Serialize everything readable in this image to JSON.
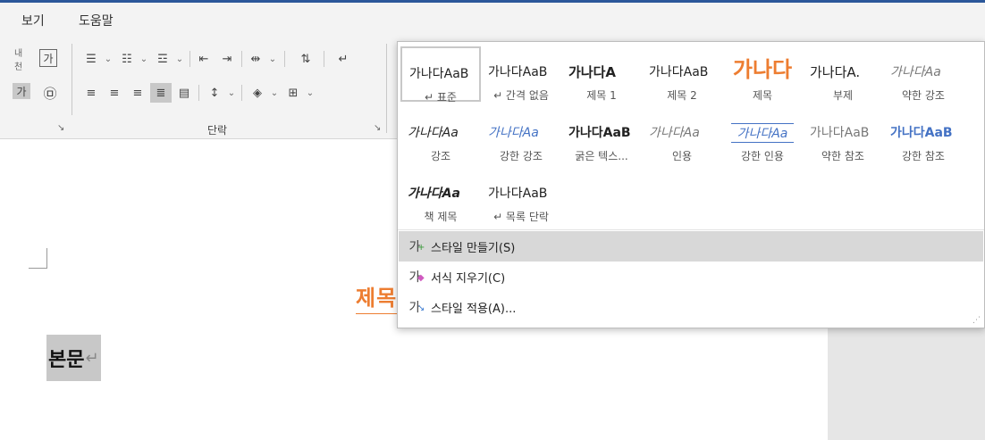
{
  "menu": {
    "items": [
      "보기",
      "도움말"
    ]
  },
  "ribbon": {
    "paragraph_group_label": "단락",
    "left_icons": {
      "phonetic": "내천",
      "char_border": "가",
      "shading": "가",
      "enclose": "㉤"
    },
    "launcher_glyph": "↘"
  },
  "gallery": {
    "styles": [
      {
        "preview": "가나다AaB",
        "name": "↵ 표준"
      },
      {
        "preview": "가나다AaB",
        "name": "↵ 간격 없음"
      },
      {
        "preview": "가나다A",
        "name": "제목 1"
      },
      {
        "preview": "가나다AaB",
        "name": "제목 2"
      },
      {
        "preview": "가나다",
        "name": "제목"
      },
      {
        "preview": "가나다A.",
        "name": "부제"
      },
      {
        "preview": "가나다Aa",
        "name": "약한 강조"
      },
      {
        "preview": "가나다Aa",
        "name": "강조"
      },
      {
        "preview": "가나다Aa",
        "name": "강한 강조"
      },
      {
        "preview": "가나다AaB",
        "name": "굵은 텍스..."
      },
      {
        "preview": "가나다Aa",
        "name": "인용"
      },
      {
        "preview": "가나다Aa",
        "name": "강한 인용"
      },
      {
        "preview": "가나다AaB",
        "name": "약한 참조"
      },
      {
        "preview": "가나다AaB",
        "name": "강한 참조"
      },
      {
        "preview": "가나다Aa",
        "name": "책 제목"
      },
      {
        "preview": "가나다AaB",
        "name": "↵ 목록 단락"
      }
    ],
    "commands": [
      {
        "label": "스타일 만들기(S)",
        "icon": "가"
      },
      {
        "label": "서식 지우기(C)",
        "icon": "가"
      },
      {
        "label": "스타일 적용(A)...",
        "icon": "가"
      }
    ]
  },
  "document": {
    "heading": "제목",
    "body": "본문",
    "para_mark": "↵"
  },
  "colors": {
    "accent": "#2b579a",
    "heading": "#ed7d31",
    "emphasis_blue": "#4472c4"
  }
}
